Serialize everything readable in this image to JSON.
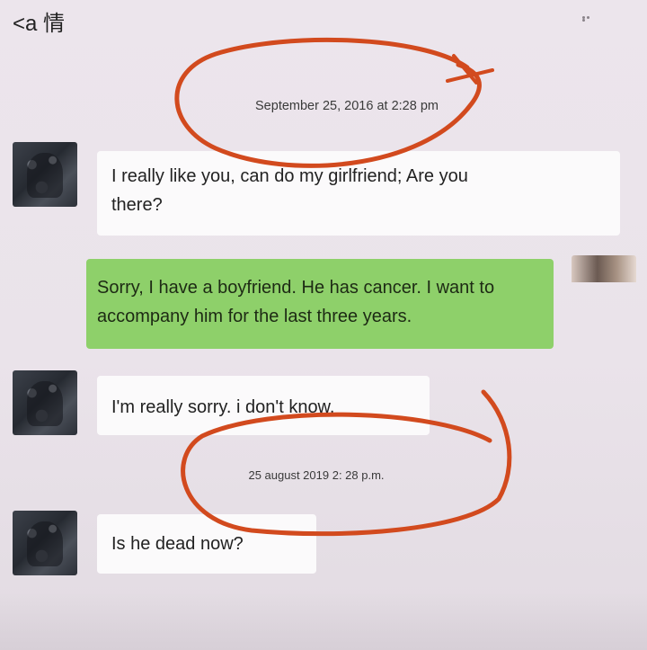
{
  "header": {
    "back_label": "<a 情",
    "more_icon": "more-dots-icon"
  },
  "timestamps": {
    "first": "September 25, 2016 at 2:28 pm",
    "second": "25 august 2019 2: 28 p.m."
  },
  "messages": [
    {
      "side": "left",
      "text_line1": "I really like you, can do my girlfriend; Are you",
      "text_line2": "there?"
    },
    {
      "side": "right",
      "text_line1": "Sorry, I have a boyfriend. He has cancer. I want to",
      "text_line2": "accompany him for the last three years."
    },
    {
      "side": "left",
      "text_line1": "I'm really sorry. i don't know."
    },
    {
      "side": "left",
      "text_line1": "Is he dead now?"
    }
  ],
  "annotation_color": "#d24a1e",
  "colors": {
    "right_bubble": "#8ed06a",
    "left_bubble": "#fbfafb",
    "background": "#ece5ec"
  }
}
